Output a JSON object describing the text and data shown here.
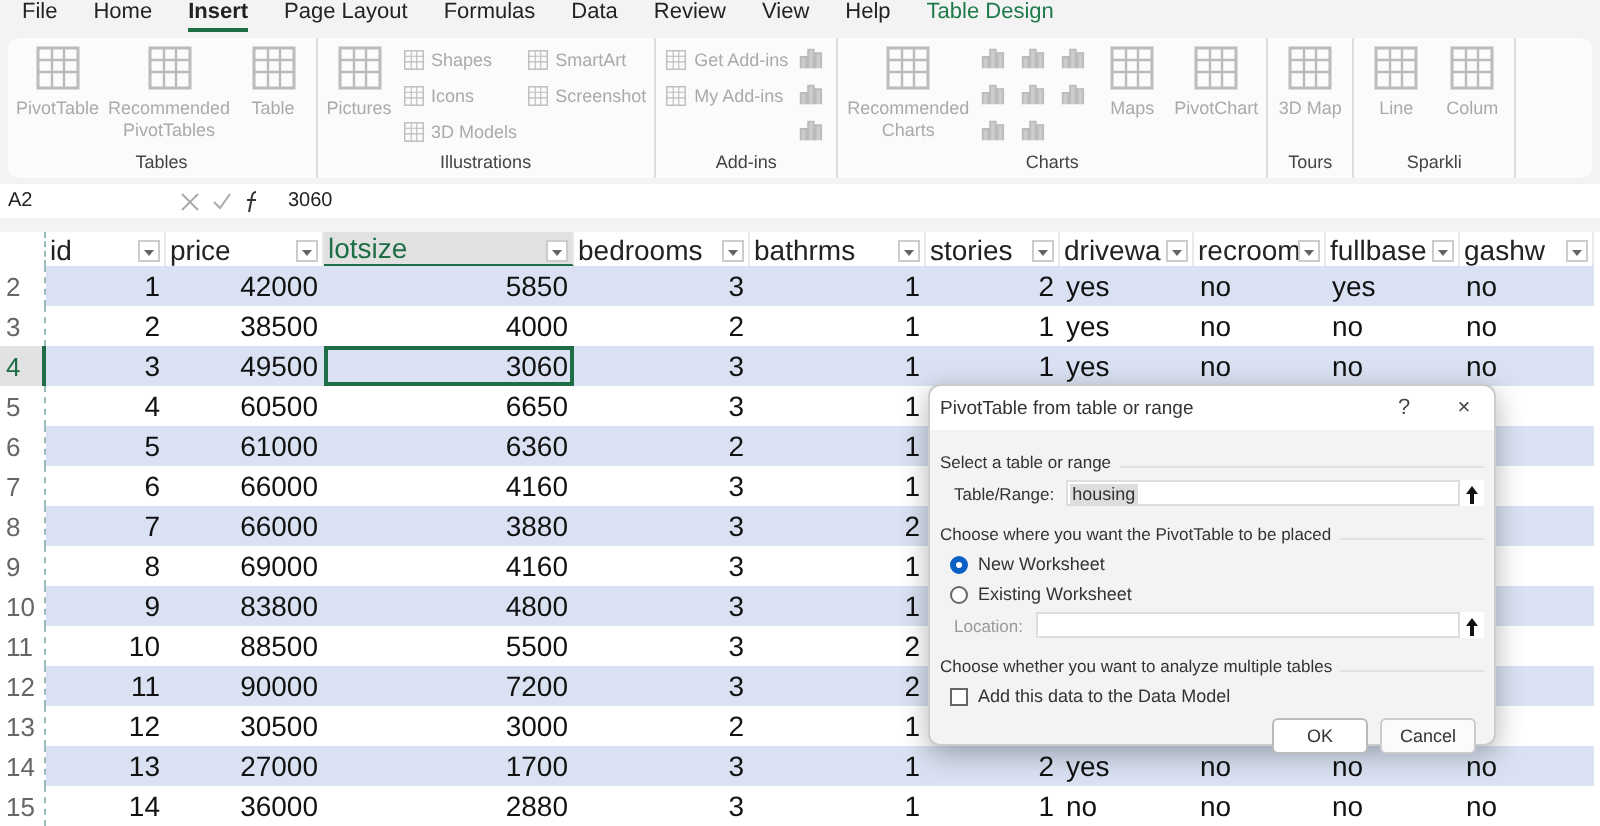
{
  "menu_tabs": [
    {
      "label": "File",
      "selected": false,
      "kind": "plain"
    },
    {
      "label": "Home",
      "selected": false,
      "kind": "plain"
    },
    {
      "label": "Insert",
      "selected": true,
      "kind": "plain"
    },
    {
      "label": "Page Layout",
      "selected": false,
      "kind": "plain"
    },
    {
      "label": "Formulas",
      "selected": false,
      "kind": "plain"
    },
    {
      "label": "Data",
      "selected": false,
      "kind": "plain"
    },
    {
      "label": "Review",
      "selected": false,
      "kind": "plain"
    },
    {
      "label": "View",
      "selected": false,
      "kind": "plain"
    },
    {
      "label": "Help",
      "selected": false,
      "kind": "plain"
    },
    {
      "label": "Table Design",
      "selected": false,
      "kind": "contextual"
    }
  ],
  "ribbon": {
    "groups": [
      {
        "label": "Tables",
        "items": [
          {
            "kind": "large",
            "label": "PivotTable"
          },
          {
            "kind": "large",
            "label": "Recommended PivotTables"
          },
          {
            "kind": "large",
            "label": "Table"
          }
        ]
      },
      {
        "label": "Illustrations",
        "items": [
          {
            "kind": "large",
            "label": "Pictures"
          },
          {
            "kind": "small",
            "label": "Shapes"
          },
          {
            "kind": "small",
            "label": "Icons"
          },
          {
            "kind": "small",
            "label": "3D Models"
          },
          {
            "kind": "small",
            "label": "SmartArt"
          },
          {
            "kind": "small",
            "label": "Screenshot"
          }
        ]
      },
      {
        "label": "Add-ins",
        "items": [
          {
            "kind": "small",
            "label": "Get Add-ins"
          },
          {
            "kind": "small",
            "label": "My Add-ins"
          },
          {
            "kind": "break"
          },
          {
            "kind": "icon"
          },
          {
            "kind": "icon"
          },
          {
            "kind": "icon"
          }
        ]
      },
      {
        "label": "Charts",
        "items": [
          {
            "kind": "large",
            "label": "Recommended Charts"
          },
          {
            "kind": "icon"
          },
          {
            "kind": "icon"
          },
          {
            "kind": "icon"
          },
          {
            "kind": "icon"
          },
          {
            "kind": "icon"
          },
          {
            "kind": "icon"
          },
          {
            "kind": "icon"
          },
          {
            "kind": "icon"
          },
          {
            "kind": "large",
            "label": "Maps"
          },
          {
            "kind": "large",
            "label": "PivotChart"
          }
        ]
      },
      {
        "label": "Tours",
        "items": [
          {
            "kind": "large",
            "label": "3D Map"
          }
        ]
      },
      {
        "label": "Sparkli",
        "items": [
          {
            "kind": "large",
            "label": "Line"
          },
          {
            "kind": "large",
            "label": "Colum"
          }
        ]
      }
    ]
  },
  "formula_bar": {
    "name_box": "A2",
    "formula": "3060"
  },
  "table": {
    "columns": [
      {
        "label": "id",
        "kind": "number",
        "selected": false
      },
      {
        "label": "price",
        "kind": "number",
        "selected": false
      },
      {
        "label": "lotsize",
        "kind": "number",
        "selected": true
      },
      {
        "label": "bedrooms",
        "kind": "number",
        "selected": false
      },
      {
        "label": "bathrms",
        "kind": "number",
        "selected": false
      },
      {
        "label": "stories",
        "kind": "number",
        "selected": false
      },
      {
        "label": "drivewa",
        "kind": "text",
        "selected": false
      },
      {
        "label": "recroom",
        "kind": "text",
        "selected": false
      },
      {
        "label": "fullbase",
        "kind": "text",
        "selected": false
      },
      {
        "label": "gashw",
        "kind": "text",
        "selected": false
      }
    ],
    "rows": [
      {
        "number": "2",
        "selected": false,
        "cells": [
          "1",
          "42000",
          "5850",
          "3",
          "1",
          "2",
          "yes",
          "no",
          "yes",
          "no"
        ]
      },
      {
        "number": "3",
        "selected": false,
        "cells": [
          "2",
          "38500",
          "4000",
          "2",
          "1",
          "1",
          "yes",
          "no",
          "no",
          "no"
        ]
      },
      {
        "number": "4",
        "selected": true,
        "cells": [
          "3",
          "49500",
          "3060",
          "3",
          "1",
          "1",
          "yes",
          "no",
          "no",
          "no"
        ]
      },
      {
        "number": "5",
        "selected": false,
        "cells": [
          "4",
          "60500",
          "6650",
          "3",
          "1"
        ]
      },
      {
        "number": "6",
        "selected": false,
        "cells": [
          "5",
          "61000",
          "6360",
          "2",
          "1"
        ]
      },
      {
        "number": "7",
        "selected": false,
        "cells": [
          "6",
          "66000",
          "4160",
          "3",
          "1"
        ]
      },
      {
        "number": "8",
        "selected": false,
        "cells": [
          "7",
          "66000",
          "3880",
          "3",
          "2"
        ]
      },
      {
        "number": "9",
        "selected": false,
        "cells": [
          "8",
          "69000",
          "4160",
          "3",
          "1"
        ]
      },
      {
        "number": "10",
        "selected": false,
        "cells": [
          "9",
          "83800",
          "4800",
          "3",
          "1"
        ]
      },
      {
        "number": "11",
        "selected": false,
        "cells": [
          "10",
          "88500",
          "5500",
          "3",
          "2"
        ]
      },
      {
        "number": "12",
        "selected": false,
        "cells": [
          "11",
          "90000",
          "7200",
          "3",
          "2"
        ]
      },
      {
        "number": "13",
        "selected": false,
        "cells": [
          "12",
          "30500",
          "3000",
          "2",
          "1"
        ]
      },
      {
        "number": "14",
        "selected": false,
        "cells": [
          "13",
          "27000",
          "1700",
          "3",
          "1",
          "2",
          "yes",
          "no",
          "no",
          "no"
        ]
      },
      {
        "number": "15",
        "selected": false,
        "cells": [
          "14",
          "36000",
          "2880",
          "3",
          "1",
          "1",
          "no",
          "no",
          "no",
          "no"
        ]
      }
    ]
  },
  "dialog": {
    "title": "PivotTable from table or range",
    "help": "?",
    "close": "×",
    "sections": [
      {
        "heading": "Select a table or range",
        "kind": "range",
        "label": "Table/Range:",
        "value": "housing"
      },
      {
        "heading": "Choose where you want the PivotTable to be placed",
        "kind": "placement",
        "options": [
          {
            "label": "New Worksheet",
            "selected": true
          },
          {
            "label": "Existing Worksheet",
            "selected": false
          }
        ],
        "location": {
          "label": "Location:",
          "disabled": true
        }
      },
      {
        "heading": "Choose whether you want to analyze multiple tables",
        "kind": "model",
        "checkbox": {
          "label": "Add this data to the Data Model",
          "checked": false
        }
      }
    ],
    "buttons": [
      "OK",
      "Cancel"
    ]
  }
}
